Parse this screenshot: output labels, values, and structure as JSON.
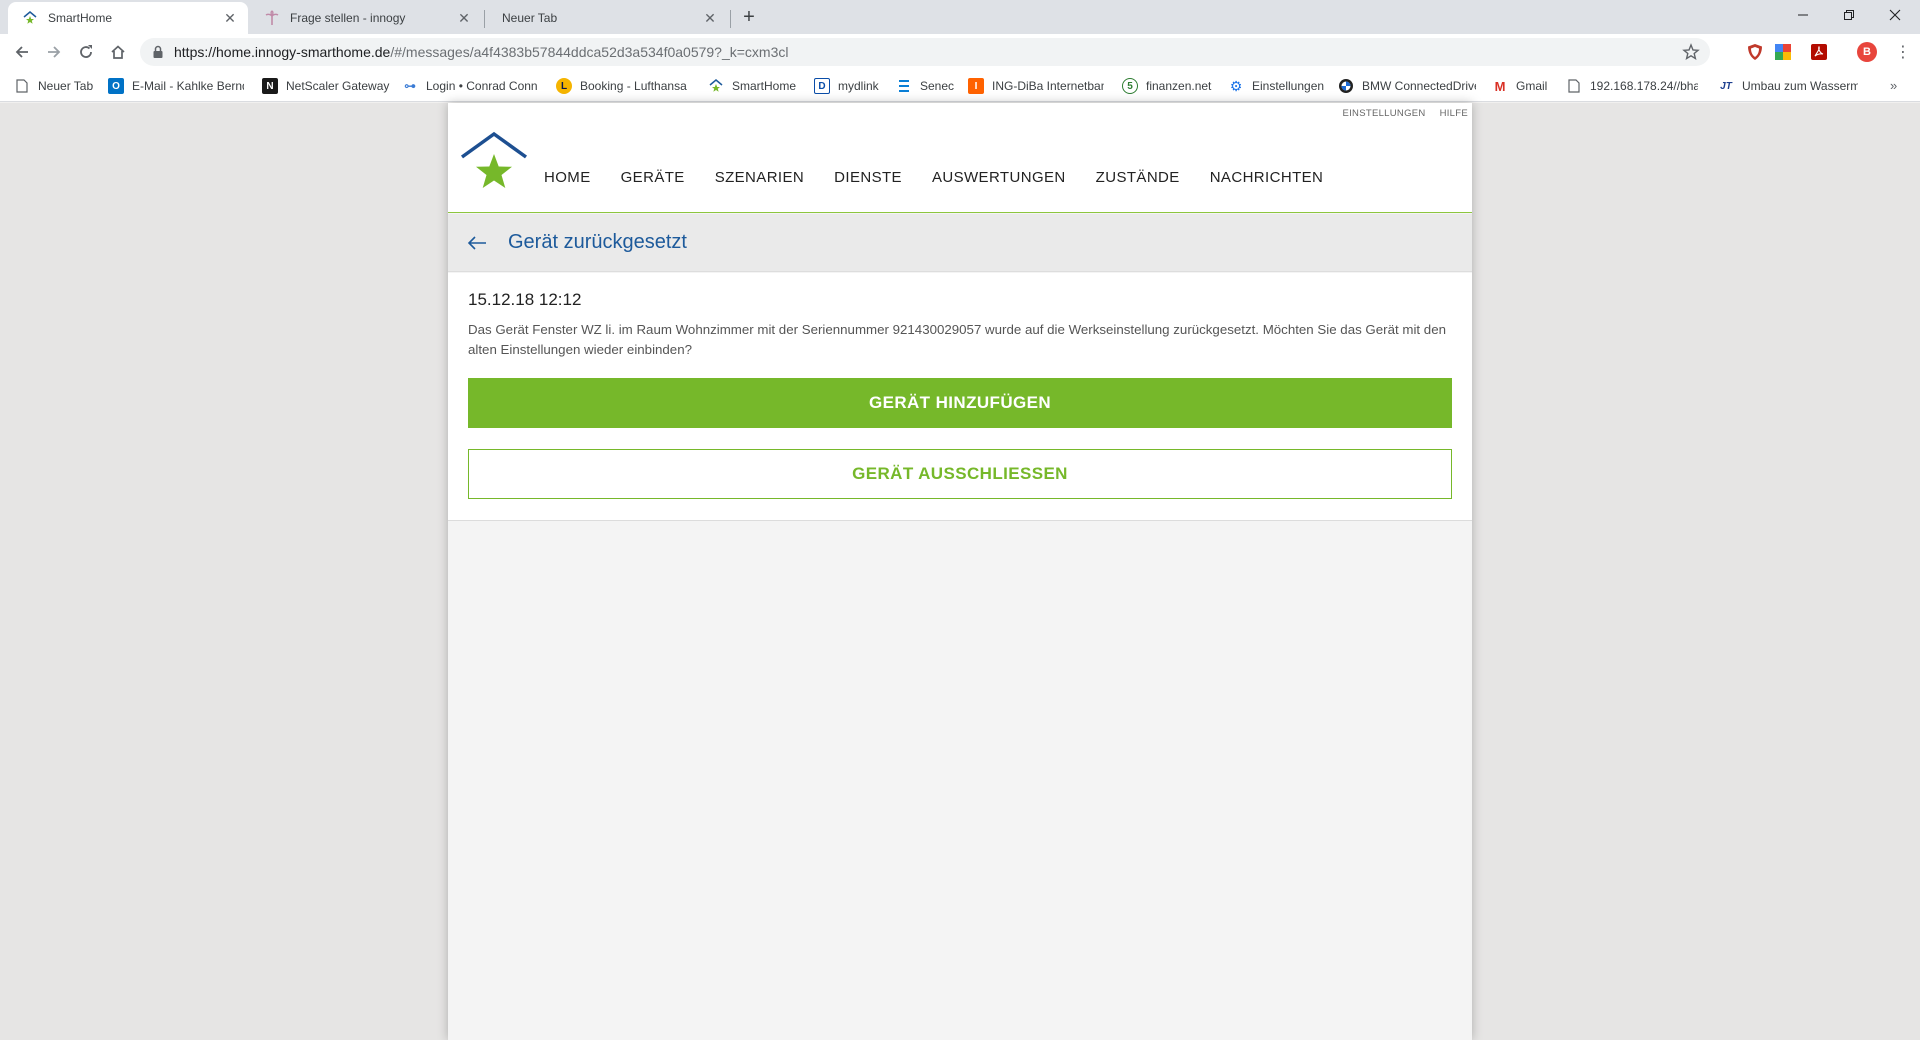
{
  "browser": {
    "tabs": [
      {
        "title": "SmartHome",
        "active": true
      },
      {
        "title": "Frage stellen - innogy",
        "active": false
      },
      {
        "title": "Neuer Tab",
        "active": false
      }
    ],
    "url_main": "https://home.innogy-smarthome.de",
    "url_rest": "/#/messages/a4f4383b57844ddca52d3a534f0a0579?_k=cxm3cl",
    "profile_initial": "B",
    "bookmarks": [
      {
        "label": "Neuer Tab"
      },
      {
        "label": "E-Mail - Kahlke Bernd"
      },
      {
        "label": "NetScaler Gateway"
      },
      {
        "label": "Login • Conrad Connect"
      },
      {
        "label": "Booking - Lufthansa"
      },
      {
        "label": "SmartHome"
      },
      {
        "label": "mydlink"
      },
      {
        "label": "Senec"
      },
      {
        "label": "ING-DiBa Internetbanking"
      },
      {
        "label": "finanzen.net"
      },
      {
        "label": "Einstellungen"
      },
      {
        "label": "BMW ConnectedDrive"
      },
      {
        "label": "Gmail"
      },
      {
        "label": "192.168.178.24//bha"
      },
      {
        "label": "Umbau zum Wasserm"
      }
    ]
  },
  "app": {
    "top_links": {
      "settings": "EINSTELLUNGEN",
      "help": "HILFE"
    },
    "nav": [
      "HOME",
      "GERÄTE",
      "SZENARIEN",
      "DIENSTE",
      "AUSWERTUNGEN",
      "ZUSTÄNDE",
      "NACHRICHTEN"
    ],
    "subheader_title": "Gerät zurückgesetzt",
    "message": {
      "date": "15.12.18 12:12",
      "text": "Das Gerät Fenster WZ li. im Raum Wohnzimmer mit der Seriennummer 921430029057 wurde auf die Werkseinstellung zurückgesetzt. Möchten Sie das Gerät mit den alten Einstellungen wieder einbinden?"
    },
    "buttons": {
      "add": "GERÄT HINZUFÜGEN",
      "exclude": "GERÄT AUSSCHLIESSEN"
    }
  },
  "colors": {
    "brand_green": "#76b82a",
    "brand_blue": "#1d5a9b"
  }
}
